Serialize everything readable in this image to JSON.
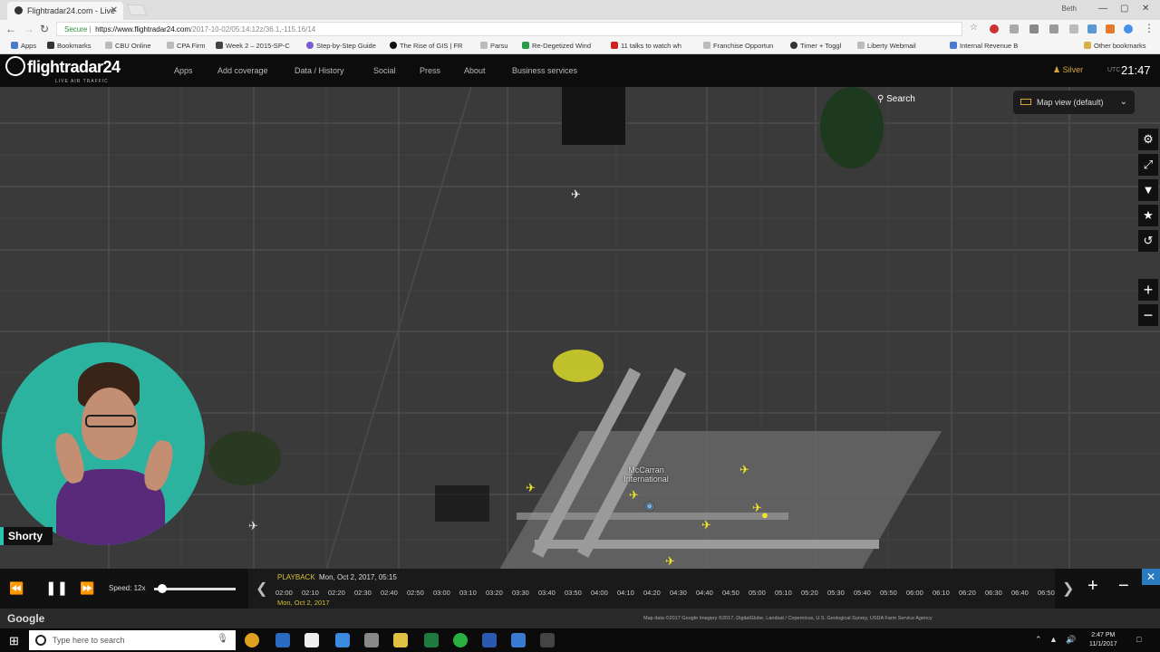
{
  "browser": {
    "tab_title": "Flightradar24.com - Live",
    "user_label": "Beth",
    "url_secure": "Secure",
    "url_domain": "https://www.flightradar24.com",
    "url_path": "/2017-10-02/05:14:12z/36.1,-115.16/14",
    "bookmarks": [
      "Apps",
      "Bookmarks",
      "CBU Online",
      "CPA Firm",
      "Week 2 – 2015-SP-C",
      "Step-by-Step Guide",
      "The Rise of GIS | FR",
      "Parsu",
      "Re-Degetized Wind",
      "11 talks to watch wh",
      "Franchise Opportun",
      "Timer + Toggl",
      "Liberty Webmail",
      "Internal Revenue B",
      "Other bookmarks"
    ]
  },
  "fr24": {
    "logo": "flightradar24",
    "logo_sub": "LIVE AIR TRAFFIC",
    "nav": [
      "Apps",
      "Add coverage",
      "Data / History",
      "Social",
      "Press",
      "About",
      "Business services"
    ],
    "account": "Silver",
    "utc_label": "UTC",
    "time": "21:47"
  },
  "map": {
    "search_label": "Search",
    "map_view_label": "Map view (default)",
    "airport_label": "McCarran International",
    "side_tools": [
      "gear-icon",
      "fullscreen-icon",
      "filter-icon",
      "star-icon",
      "history-icon"
    ],
    "zoom_in": "+",
    "zoom_out": "−"
  },
  "webcam": {
    "name": "Shorty"
  },
  "playback": {
    "speed_label": "Speed: 12x",
    "speed_fraction": 0.05,
    "playback_label": "PLAYBACK",
    "playback_date": "Mon, Oct 2, 2017, 05:15",
    "timeline_date": "Mon, Oct 2, 2017",
    "ticks": [
      "02:00",
      "02:10",
      "02:20",
      "02:30",
      "02:40",
      "02:50",
      "03:00",
      "03:10",
      "03:20",
      "03:30",
      "03:40",
      "03:50",
      "04:00",
      "04:10",
      "04:20",
      "04:30",
      "04:40",
      "04:50",
      "05:00",
      "05:10",
      "05:20",
      "05:30",
      "05:40",
      "05:50",
      "06:00",
      "06:10",
      "06:20",
      "06:30",
      "06:40",
      "06:50"
    ],
    "close": "✕"
  },
  "attribution": {
    "google": "Google",
    "credit": "Map data ©2017 Google Imagery ©2017, DigitalGlobe, Landsat / Copernicus, U.S. Geological Survey, USDA Farm Service Agency"
  },
  "taskbar": {
    "search_placeholder": "Type here to search",
    "time": "2:47 PM",
    "date": "11/1/2017"
  },
  "colors": {
    "accent_yellow": "#f2e526",
    "fr24_gold": "#d4a83a",
    "webcam_bg": "#2bb3a0"
  }
}
